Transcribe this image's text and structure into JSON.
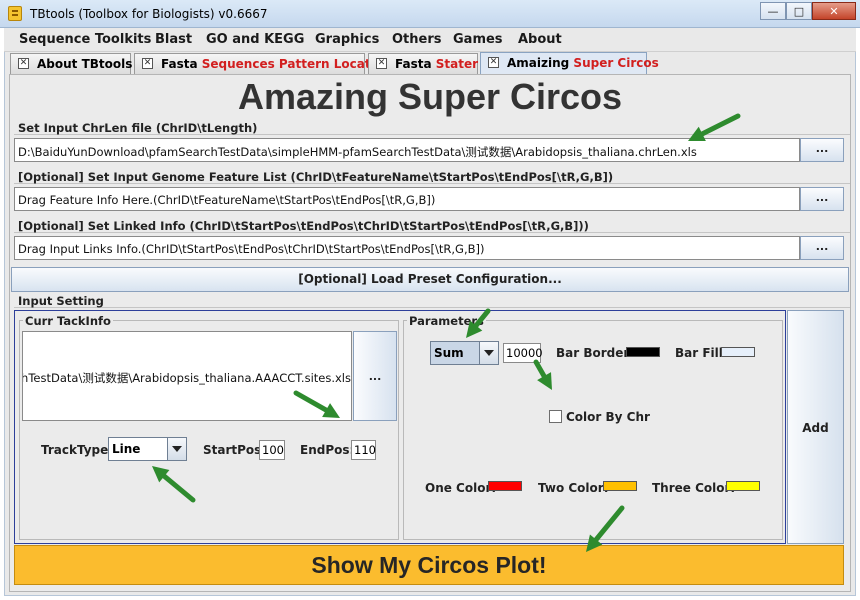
{
  "window": {
    "title": "TBtools (Toolbox for Biologists) v0.6667",
    "minimize": "—",
    "maximize": "□",
    "close": "✕"
  },
  "menubar": [
    "Sequence Toolkits",
    "Blast",
    "GO and KEGG",
    "Graphics",
    "Others",
    "Games",
    "About"
  ],
  "tabs": [
    {
      "prefix": "About TBtools",
      "highlight": ""
    },
    {
      "prefix": "Fasta ",
      "highlight": "Sequences Pattern Locator"
    },
    {
      "prefix": "Fasta ",
      "highlight": "Stater"
    },
    {
      "prefix": "Amaizing ",
      "highlight": "Super Circos"
    }
  ],
  "main": {
    "title": "Amazing Super Circos",
    "chrlen": {
      "label": "Set Input ChrLen file (ChrID\\tLength)",
      "value": "D:\\BaiduYunDownload\\pfamSearchTestData\\simpleHMM-pfamSearchTestData\\测试数据\\Arabidopsis_thaliana.chrLen.xls",
      "button": "..."
    },
    "feature": {
      "label": "[Optional] Set Input Genome Feature List (ChrID\\tFeatureName\\tStartPos\\tEndPos[\\tR,G,B])",
      "value": "Drag Feature Info Here.(ChrID\\tFeatureName\\tStartPos\\tEndPos[\\tR,G,B])",
      "button": "..."
    },
    "links": {
      "label": "[Optional] Set Linked Info (ChrID\\tStartPos\\tEndPos\\tChrID\\tStartPos\\tEndPos[\\tR,G,B]))",
      "value": "Drag Input Links Info.(ChrID\\tStartPos\\tEndPos\\tChrID\\tStartPos\\tEndPos[\\tR,G,B])",
      "button": "..."
    },
    "preset_button": "[Optional] Load Preset Configuration...",
    "input_setting": {
      "label": "Input Setting",
      "curr_track": {
        "label": "Curr TackInfo",
        "value": "hTestData\\测试数据\\Arabidopsis_thaliana.AAACCT.sites.xls",
        "button": "...",
        "track_type_label": "TrackType:",
        "track_type": "Line",
        "start_label": "StartPos:",
        "start_value": "100",
        "end_label": "EndPos:",
        "end_value": "110"
      },
      "parameters": {
        "label": "Parameters",
        "mode": "Sum",
        "window": "10000",
        "bar_border_label": "Bar Border:",
        "bar_border_color": "#000000",
        "bar_fill_label": "Bar Fill:",
        "bar_fill_color": "#e6effa",
        "color_by_chr_label": "Color By Chr",
        "color_by_chr": false,
        "one_color_label": "One Color:",
        "one_color": "#ff0000",
        "two_color_label": "Two Color:",
        "two_color": "#ffc000",
        "three_color_label": "Three Color:",
        "three_color": "#ffff00"
      },
      "add_button": "Add"
    },
    "show_button": "Show My Circos Plot!"
  },
  "annotation_color": "#2e8b2e"
}
